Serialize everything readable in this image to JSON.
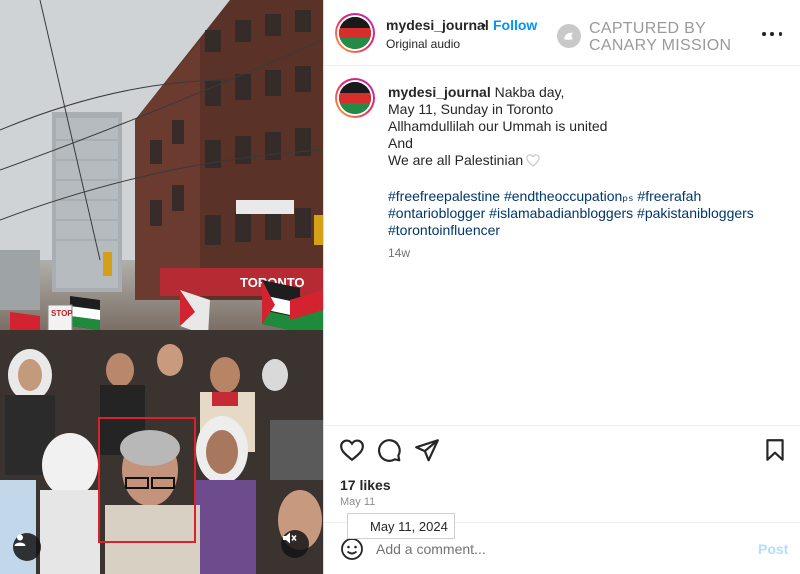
{
  "post": {
    "username": "mydesi_journal",
    "dot": "•",
    "follow_label": "Follow",
    "audio_label": "Original audio",
    "more_icon": "more-horizontal-icon"
  },
  "watermark": {
    "line1": "CAPTURED BY",
    "line2": "CANARY MISSION",
    "icon": "canary-bird-icon"
  },
  "photo": {
    "sign_text": "STOP",
    "store_sign": "TORONTO",
    "avatar_icon": "person-icon",
    "mute_icon": "speaker-muted-icon",
    "highlight_color": "#d9232a"
  },
  "caption": {
    "username": "mydesi_journal",
    "lines": [
      "Nakba day,",
      "May 11, Sunday in Toronto",
      "Allhamdullilah our Ummah is united",
      "And",
      "We are all Palestinian"
    ],
    "hashtags": [
      "#freefreepalestine #endtheoccupation",
      "#ontarioblogger #islamabadianbloggers #pakistanibloggers",
      "#torontoinfluencer"
    ],
    "hashtag_line1": {
      "part1": "#freefreepalestine #endtheoccupation",
      "part2": "ₚₛ",
      "part3": " #freerafah"
    },
    "age": "14w"
  },
  "actions": {
    "like_icon": "heart-icon",
    "comment_icon": "comment-icon",
    "share_icon": "send-icon",
    "save_icon": "bookmark-icon"
  },
  "stats": {
    "likes": "17 likes",
    "date": "May 11",
    "tooltip": "May 11, 2024"
  },
  "comment": {
    "placeholder": "Add a comment...",
    "post_label": "Post",
    "emoji_icon": "smiley-icon"
  },
  "colors": {
    "follow": "#0095f6",
    "hashtag": "#00376b",
    "post_disabled": "#b2dffc",
    "highlight": "#d9232a"
  }
}
